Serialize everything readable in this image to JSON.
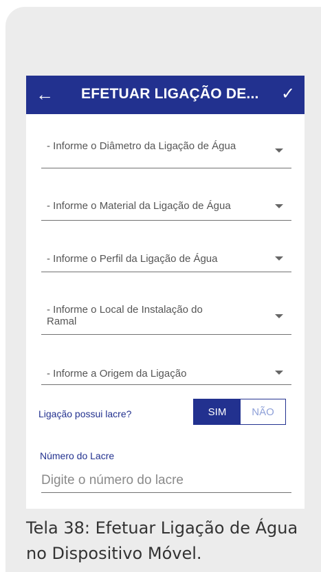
{
  "appbar": {
    "back_icon": "arrow-left-icon",
    "title": "EFETUAR LIGAÇÃO DE...",
    "confirm_icon": "check-icon",
    "color": "#22318f"
  },
  "fields": [
    {
      "label": "- Informe o Diâmetro da Ligação de Água"
    },
    {
      "label": "- Informe o Material da Ligação de Água"
    },
    {
      "label": "- Informe o Perfil da Ligação de Água"
    },
    {
      "label": "- Informe o Local de Instalação do Ramal"
    },
    {
      "label": "- Informe a Origem da Ligação"
    }
  ],
  "lacre": {
    "question": "Ligação possui lacre?",
    "yes_label": "SIM",
    "no_label": "NÃO",
    "selected": "SIM",
    "number_label": "Número do Lacre",
    "number_placeholder": "Digite o número do lacre"
  },
  "caption": "Tela 38: Efetuar Ligação de Água no Dispositivo Móvel."
}
